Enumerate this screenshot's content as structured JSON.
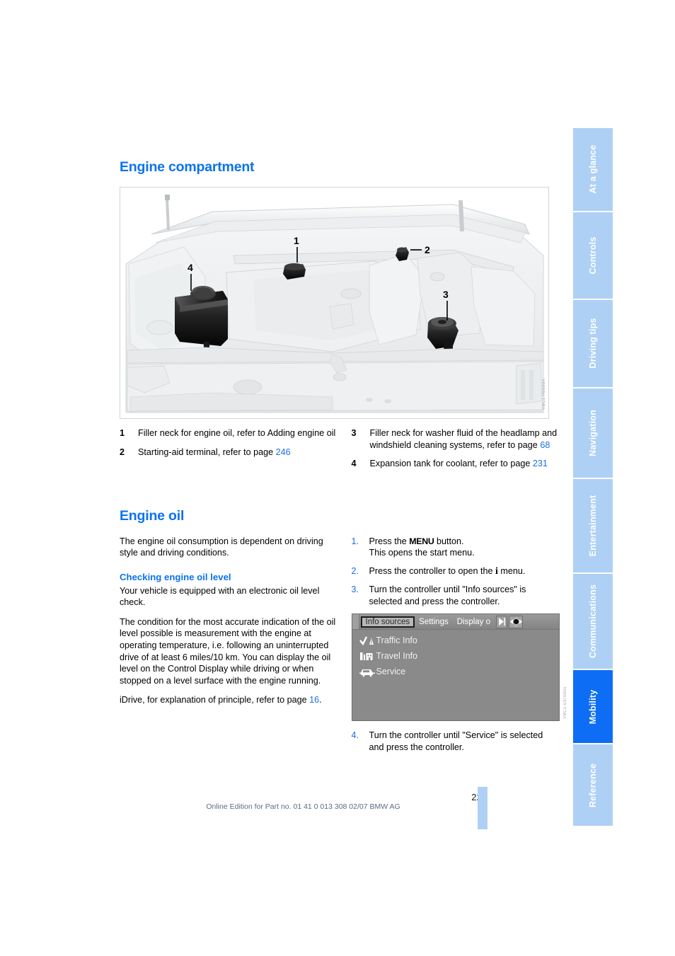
{
  "document": {
    "page_number": "229",
    "footer_note": "Online Edition for Part no. 01 41 0 013 308 02/07 BMW AG"
  },
  "sections": {
    "engine_compartment": {
      "title": "Engine compartment",
      "figure_code": "VBC1-H0599A",
      "callouts": [
        "1",
        "2",
        "3",
        "4"
      ],
      "legend": [
        {
          "num": "1",
          "text": "Filler neck for engine oil, refer to Adding engine oil",
          "ref": ""
        },
        {
          "num": "2",
          "text": "Starting-aid terminal, refer to page ",
          "ref": "246"
        },
        {
          "num": "3",
          "text": "Filler neck for washer fluid of the headlamp and windshield cleaning systems, refer to page ",
          "ref": "68"
        },
        {
          "num": "4",
          "text": "Expansion tank for coolant, refer to page ",
          "ref": "231"
        }
      ]
    },
    "engine_oil": {
      "title": "Engine oil",
      "intro": "The engine oil consumption is dependent on driving style and driving conditions.",
      "checking": {
        "title": "Checking engine oil level",
        "para1": "Your vehicle is equipped with an electronic oil level check.",
        "para2": "The condition for the most accurate indication of the oil level possible is measurement with the engine at operating temperature, i.e. following an uninterrupted drive of at least 6 miles/10 km. You can display the oil level on the Control Display while driving or when stopped on a level surface with the engine running.",
        "para3_lead": "iDrive, for explanation of principle, refer to page ",
        "para3_ref": "16",
        "para3_tail": "."
      },
      "steps": [
        {
          "num": "1.",
          "lead": "Press the ",
          "key": "MENU",
          "tail": " button.",
          "line2": "This opens the start menu."
        },
        {
          "num": "2.",
          "lead": "Press the controller to open the ",
          "key": "i",
          "tail": " menu.",
          "line2": ""
        },
        {
          "num": "3.",
          "lead": "Turn the controller until \"Info sources\" is selected and press the controller.",
          "key": "",
          "tail": "",
          "line2": ""
        },
        {
          "num": "4.",
          "lead": "Turn the controller until \"Service\" is selected and press the controller.",
          "key": "",
          "tail": "",
          "line2": ""
        }
      ]
    }
  },
  "idrive_screenshot": {
    "figure_code": "VBC1-0370001",
    "tabs": [
      {
        "label": "Info sources",
        "selected": true
      },
      {
        "label": "Settings",
        "selected": false
      },
      {
        "label": "Display o",
        "selected": false
      }
    ],
    "menu_items": [
      {
        "label": "Traffic Info",
        "icon": "traffic-info-icon"
      },
      {
        "label": "Travel Info",
        "icon": "travel-info-icon"
      },
      {
        "label": "Service",
        "icon": "service-icon"
      }
    ]
  },
  "tab_rail": {
    "items": [
      {
        "label": "At a glance",
        "active": false
      },
      {
        "label": "Controls",
        "active": false
      },
      {
        "label": "Driving tips",
        "active": false
      },
      {
        "label": "Navigation",
        "active": false
      },
      {
        "label": "Entertainment",
        "active": false
      },
      {
        "label": "Communications",
        "active": false
      },
      {
        "label": "Mobility",
        "active": true
      },
      {
        "label": "Reference",
        "active": false
      }
    ]
  },
  "colors": {
    "heading_blue": "#0b72ef",
    "reference_blue": "#1a6ee8",
    "tab_inactive": "#aed0f5",
    "tab_active": "#0d6ef5",
    "footer_text": "#5a6b87"
  }
}
